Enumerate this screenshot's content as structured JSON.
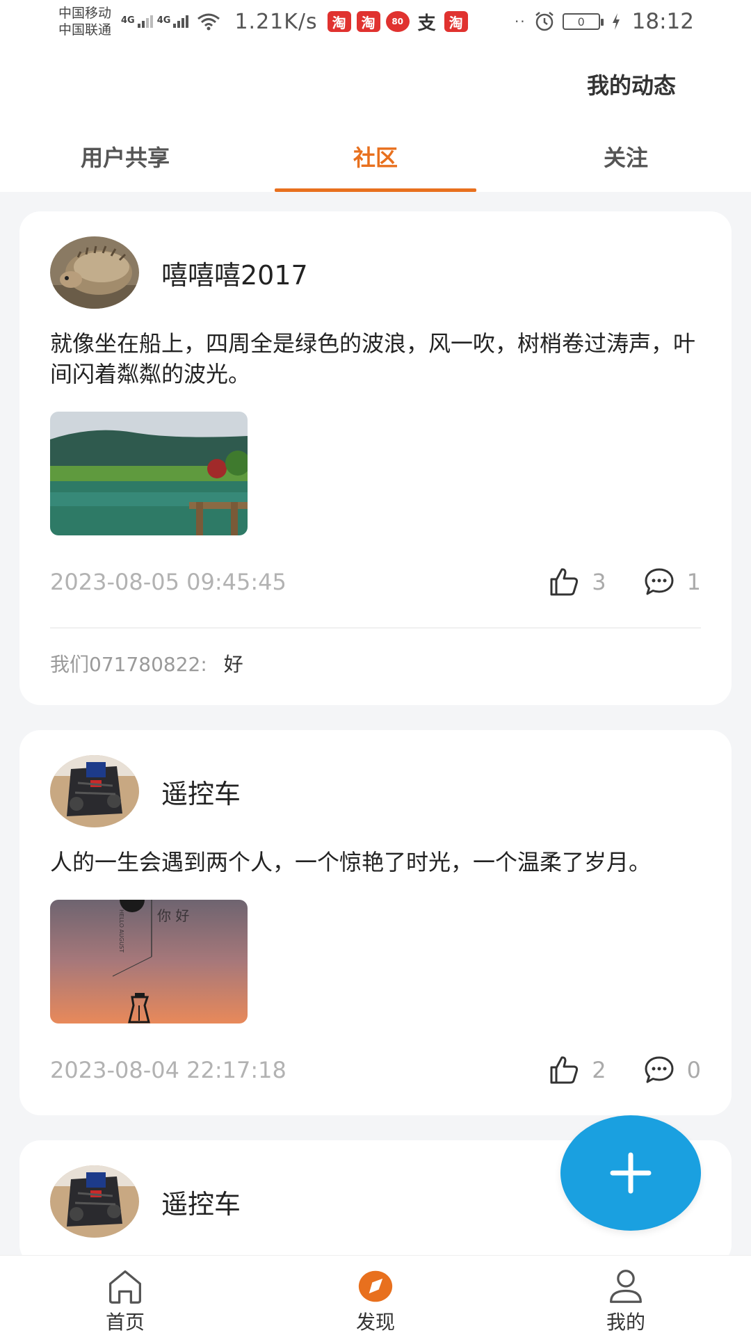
{
  "status_bar": {
    "carrier_1": "中国移动",
    "carrier_2": "中国联通",
    "network_1": "4G",
    "network_2": "4G",
    "net_speed": "1.21K/s",
    "app_badges": [
      "淘",
      "淘",
      "80",
      "支",
      "淘"
    ],
    "battery_level": "0",
    "time": "18:12"
  },
  "header": {
    "my_posts_label": "我的动态",
    "tabs": [
      {
        "label": "用户共享",
        "active": false
      },
      {
        "label": "社区",
        "active": true
      },
      {
        "label": "关注",
        "active": false
      }
    ],
    "accent_color": "#e8701e"
  },
  "posts": [
    {
      "username": "嘻嘻嘻2017",
      "avatar": "hedgehog-photo",
      "text": "就像坐在船上，四周全是绿色的波浪，风一吹，树梢卷过涛声，叶间闪着粼粼的波光。",
      "image": "lake-landscape-photo",
      "time": "2023-08-05 09:45:45",
      "likes": "3",
      "comments": "1",
      "comment_list": [
        {
          "user": "我们071780822:",
          "text": "好"
        }
      ]
    },
    {
      "username": "遥控车",
      "avatar": "rc-car-photo",
      "text": "人的一生会遇到两个人，一个惊艳了时光，一个温柔了岁月。",
      "image": "sunset-lantern-image",
      "image_text": {
        "main": "你 好",
        "side": "HELLO AUGUST"
      },
      "time": "2023-08-04 22:17:18",
      "likes": "2",
      "comments": "0"
    },
    {
      "username": "遥控车",
      "avatar": "rc-car-photo"
    }
  ],
  "fab": {
    "icon": "plus-icon",
    "color": "#1aa0e0"
  },
  "bottom_nav": [
    {
      "label": "首页",
      "icon": "home-icon"
    },
    {
      "label": "发现",
      "icon": "compass-icon",
      "active": true
    },
    {
      "label": "我的",
      "icon": "user-icon"
    }
  ]
}
